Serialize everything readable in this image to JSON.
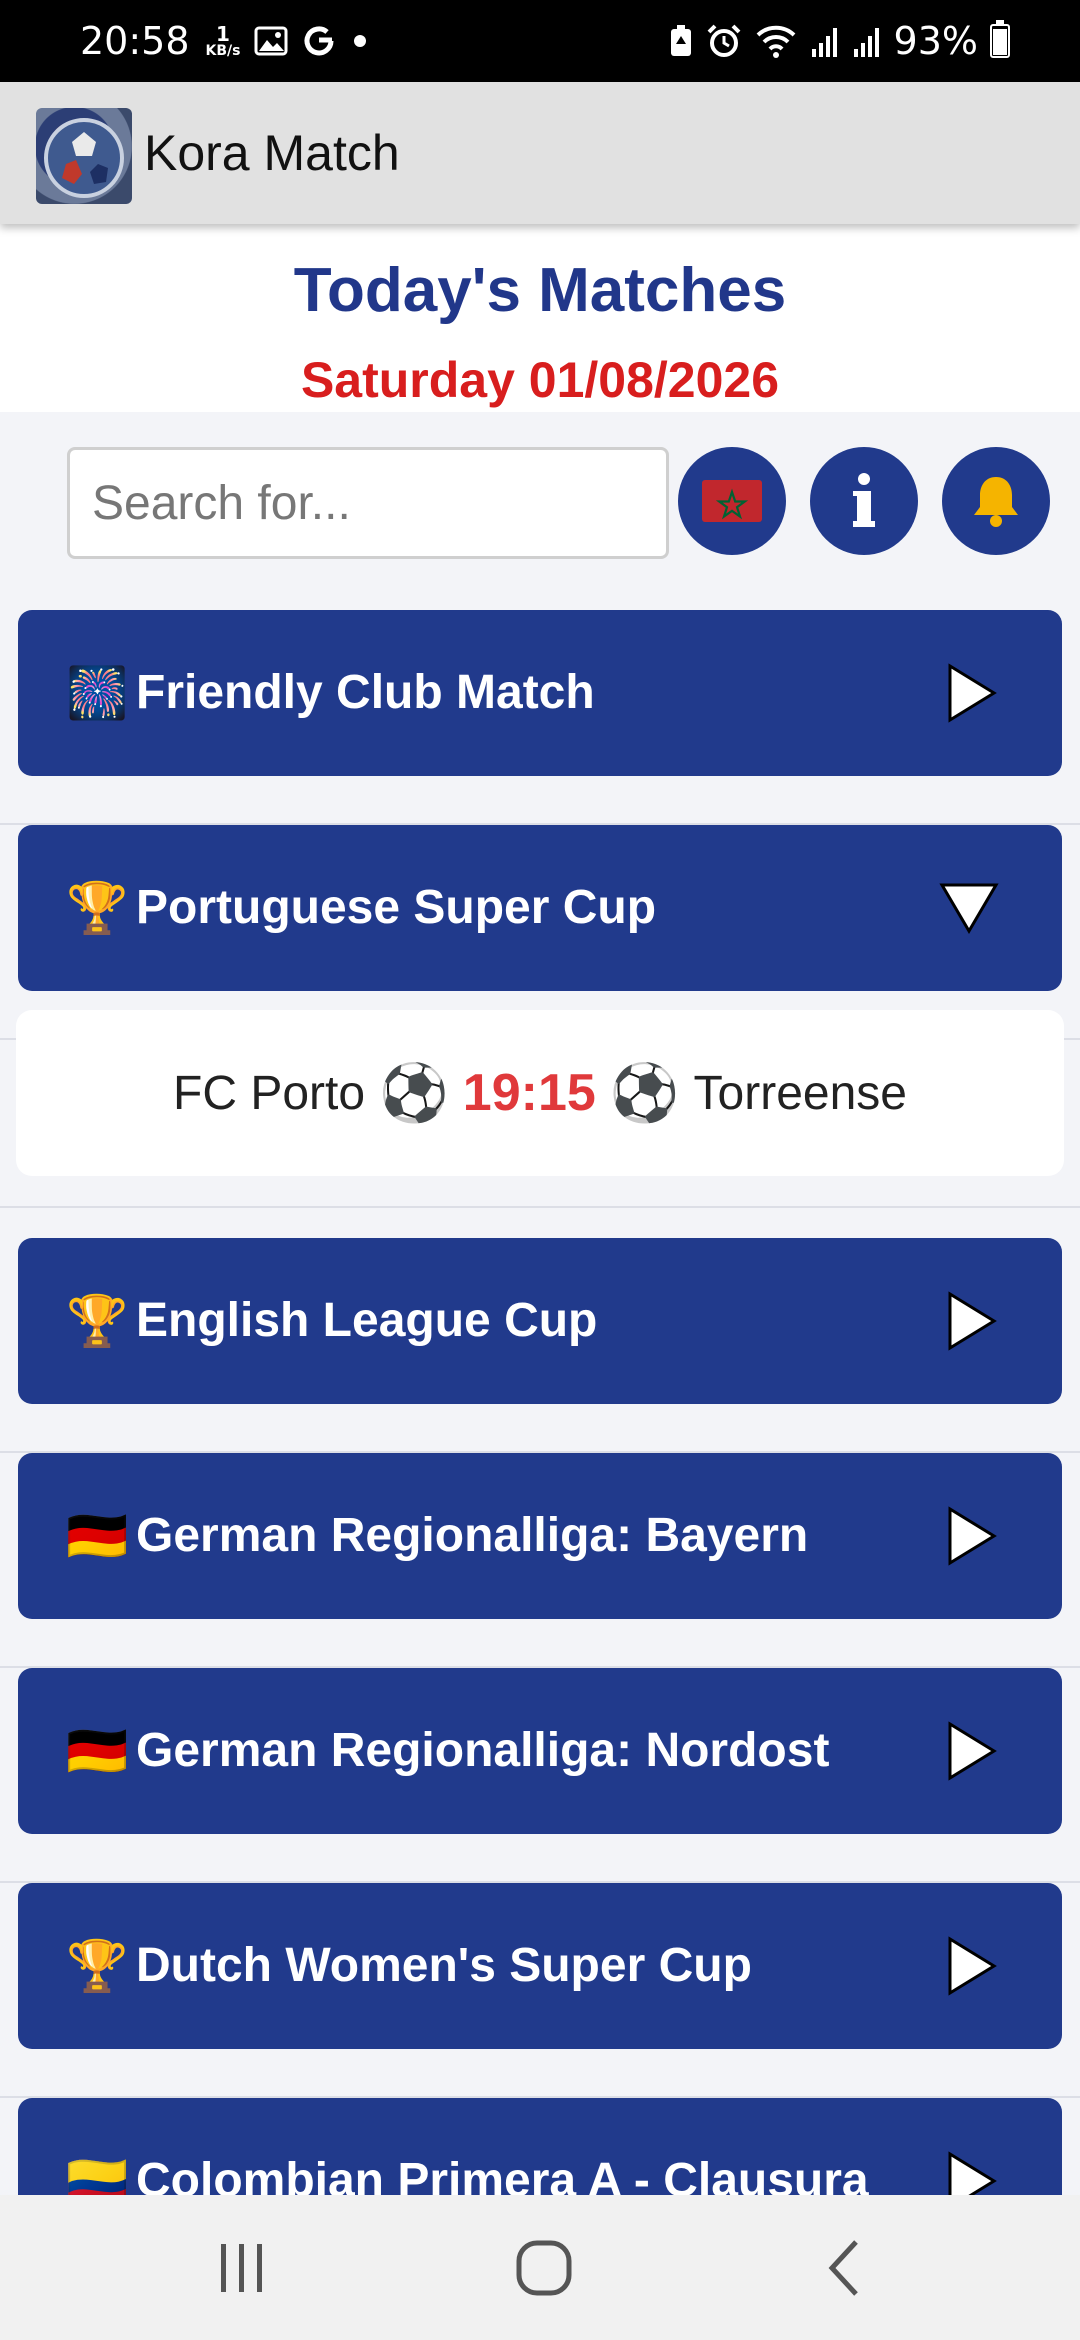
{
  "status_bar": {
    "time": "20:58",
    "net_speed_value": "1",
    "net_speed_unit": "KB/s",
    "battery": "93%"
  },
  "app_bar": {
    "title": "Kora Match"
  },
  "header": {
    "title": "Today's Matches",
    "date": "Saturday 01/08/2026"
  },
  "toolbar": {
    "search_placeholder": "Search for...",
    "buttons": [
      "flag-morocco",
      "info",
      "bell"
    ]
  },
  "competitions": [
    {
      "emoji": "🎆",
      "name": "Friendly Club Match",
      "expanded": false
    },
    {
      "emoji": "🏆",
      "name": "Portuguese Super Cup",
      "expanded": true,
      "matches": [
        {
          "home": "FC Porto",
          "time": "19:15",
          "away": "Torreense"
        }
      ]
    },
    {
      "emoji": "🏆",
      "name": "English League Cup",
      "expanded": false
    },
    {
      "emoji": "🇩🇪",
      "name": "German Regionalliga: Bayern",
      "expanded": false
    },
    {
      "emoji": "🇩🇪",
      "name": "German Regionalliga: Nordost",
      "expanded": false
    },
    {
      "emoji": "🏆",
      "name": "Dutch Women's Super Cup",
      "expanded": false
    },
    {
      "emoji": "🇨🇴",
      "name": "Colombian Primera A - Clausura",
      "expanded": false
    }
  ],
  "colors": {
    "primary": "#213a8c",
    "accent_red": "#d81e1e",
    "time_red": "#e0393b"
  }
}
